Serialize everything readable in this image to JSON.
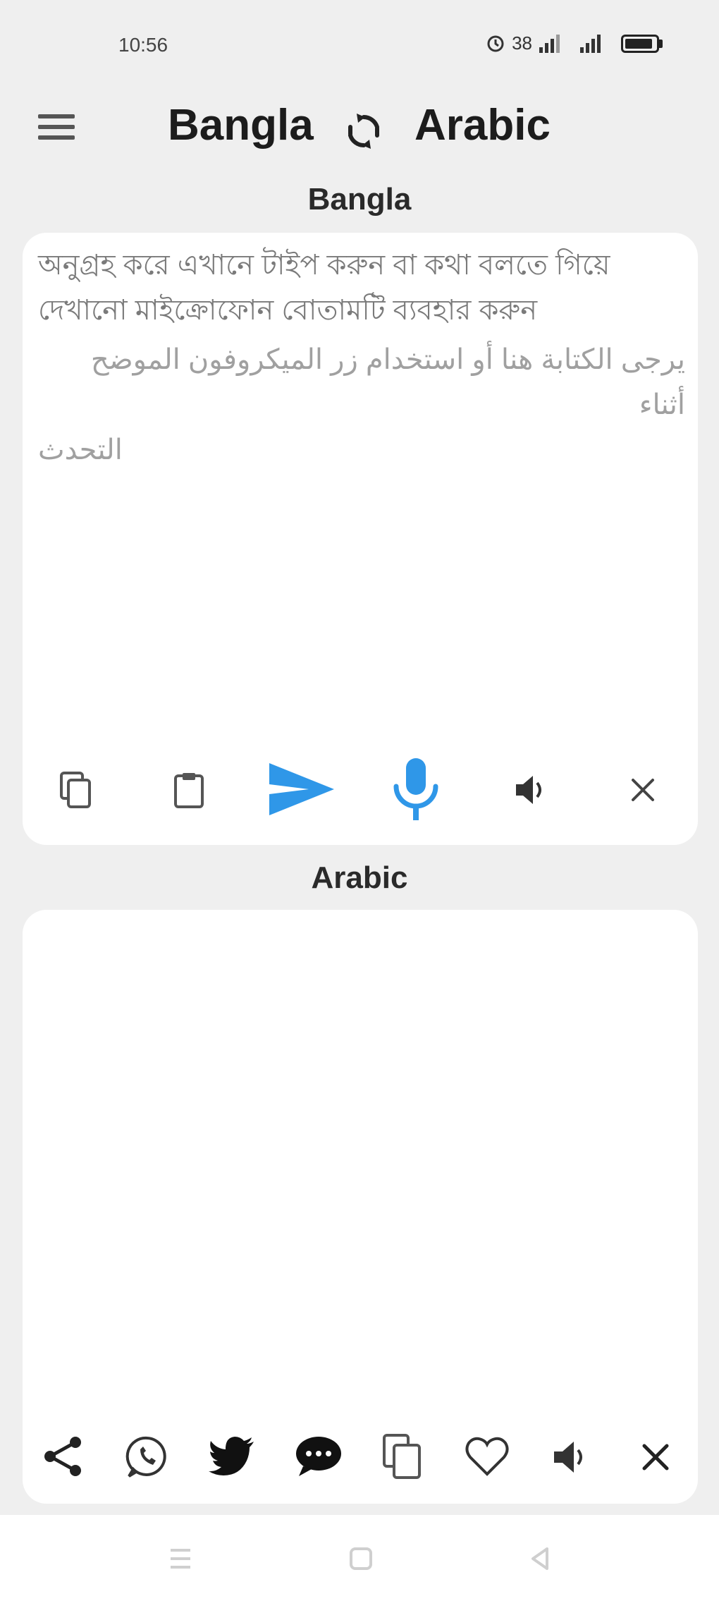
{
  "status": {
    "time": "10:56",
    "network": "38"
  },
  "header": {
    "source_language": "Bangla",
    "target_language": "Arabic"
  },
  "input_section": {
    "label": "Bangla",
    "placeholder_bn": "অনুগ্রহ করে এখানে টাইপ করুন বা কথা বলতে গিয়ে দেখানো মাইক্রোফোন বোতামটি ব্যবহার করুন",
    "placeholder_ar": "يرجى الكتابة هنا أو استخدام زر الميكروفون الموضح أثناء",
    "placeholder_ar_2": "التحدث"
  },
  "output_section": {
    "label": "Arabic",
    "text": ""
  },
  "icons": {
    "input_toolbar": [
      "copy-icon",
      "paste-icon",
      "send-icon",
      "microphone-icon",
      "speaker-icon",
      "close-icon"
    ],
    "output_toolbar": [
      "share-icon",
      "whatsapp-icon",
      "twitter-icon",
      "chat-icon",
      "copy-icon",
      "heart-icon",
      "speaker-icon",
      "close-icon"
    ],
    "nav": [
      "recents-icon",
      "home-icon",
      "back-icon"
    ]
  },
  "colors": {
    "accent": "#2f97e8",
    "background": "#efefef",
    "card": "#ffffff"
  }
}
